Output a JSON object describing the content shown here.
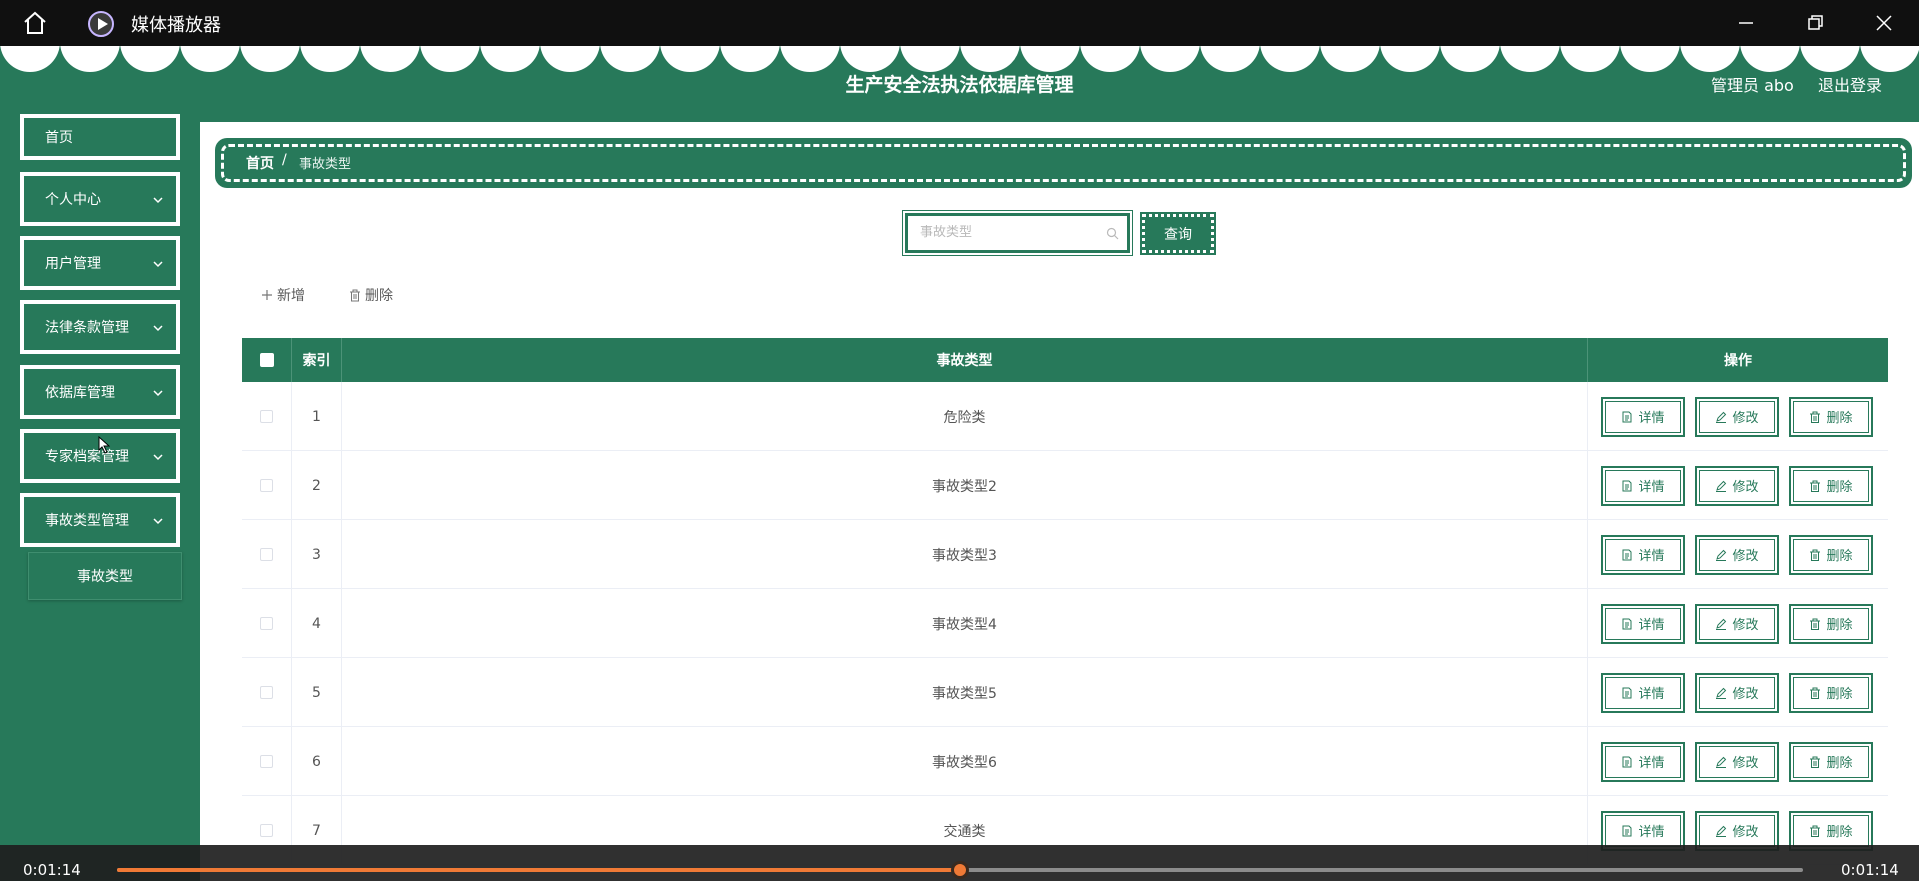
{
  "player": {
    "title": "媒体播放器",
    "time_current": "0:01:14",
    "time_total": "0:01:14",
    "progress": 0.5,
    "accent": "#f07a36"
  },
  "header": {
    "title": "生产安全法执法依据库管理",
    "user": "管理员 abo",
    "logout": "退出登录"
  },
  "sidebar": {
    "items": [
      {
        "label": "首页"
      },
      {
        "label": "个人中心"
      },
      {
        "label": "用户管理"
      },
      {
        "label": "法律条款管理"
      },
      {
        "label": "依据库管理"
      },
      {
        "label": "专家档案管理"
      },
      {
        "label": "事故类型管理"
      }
    ],
    "sub_item": "事故类型"
  },
  "breadcrumb": {
    "home": "首页",
    "separator": "/",
    "current": "事故类型"
  },
  "search": {
    "placeholder": "事故类型",
    "button": "查询"
  },
  "toolbar": {
    "add": "新增",
    "delete": "删除"
  },
  "table": {
    "headers": {
      "index": "索引",
      "type": "事故类型",
      "ops": "操作"
    },
    "rows": [
      {
        "index": "1",
        "type": "危险类"
      },
      {
        "index": "2",
        "type": "事故类型2"
      },
      {
        "index": "3",
        "type": "事故类型3"
      },
      {
        "index": "4",
        "type": "事故类型4"
      },
      {
        "index": "5",
        "type": "事故类型5"
      },
      {
        "index": "6",
        "type": "事故类型6"
      },
      {
        "index": "7",
        "type": "交通类"
      }
    ],
    "actions": {
      "detail": "详情",
      "edit": "修改",
      "delete": "删除"
    }
  },
  "colors": {
    "primary": "#27795a",
    "white": "#ffffff"
  }
}
